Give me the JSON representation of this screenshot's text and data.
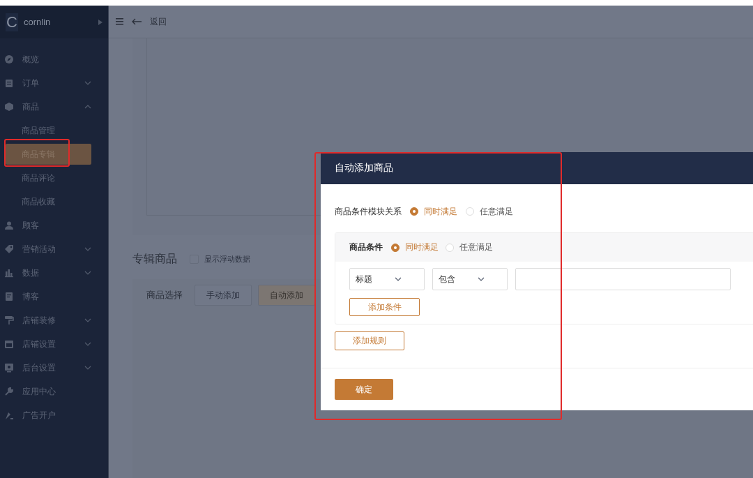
{
  "app": {
    "logo_letter": "C",
    "name": "cornlin"
  },
  "sidebar": {
    "items": [
      {
        "label": "概览"
      },
      {
        "label": "订单",
        "expanded": false
      },
      {
        "label": "商品",
        "expanded": true,
        "children": [
          {
            "label": "商品管理",
            "selected": false,
            "highlighted": false
          },
          {
            "label": "商品专辑",
            "selected": true,
            "highlighted": true
          },
          {
            "label": "商品评论",
            "selected": false,
            "highlighted": false
          },
          {
            "label": "商品收藏",
            "selected": false,
            "highlighted": false
          }
        ]
      },
      {
        "label": "顾客"
      },
      {
        "label": "营销活动",
        "expanded": false
      },
      {
        "label": "数据",
        "expanded": false
      },
      {
        "label": "博客"
      },
      {
        "label": "店铺装修",
        "expanded": false
      },
      {
        "label": "店铺设置",
        "expanded": false
      },
      {
        "label": "后台设置",
        "expanded": false
      },
      {
        "label": "应用中心"
      },
      {
        "label": "广告开户"
      }
    ]
  },
  "header": {
    "back": "返回"
  },
  "page": {
    "section_title": "专辑商品",
    "show_floating_data": {
      "label": "显示浮动数据",
      "checked": false
    },
    "product_selection": {
      "label": "商品选择",
      "modes": [
        {
          "label": "手动添加",
          "selected": false
        },
        {
          "label": "自动添加",
          "selected": true
        }
      ]
    }
  },
  "dialog": {
    "title": "自动添加商品",
    "highlighted": true,
    "relation": {
      "label": "商品条件模块关系",
      "options": [
        {
          "label": "同时满足",
          "selected": true
        },
        {
          "label": "任意满足",
          "selected": false
        }
      ]
    },
    "condition_group": {
      "label": "商品条件",
      "options": [
        {
          "label": "同时满足",
          "selected": true
        },
        {
          "label": "任意满足",
          "selected": false
        }
      ],
      "conditions": [
        {
          "field": "标题",
          "operator": "包含"
        }
      ],
      "add_condition": "添加条件"
    },
    "add_rule": "添加规则",
    "confirm": "确定"
  }
}
